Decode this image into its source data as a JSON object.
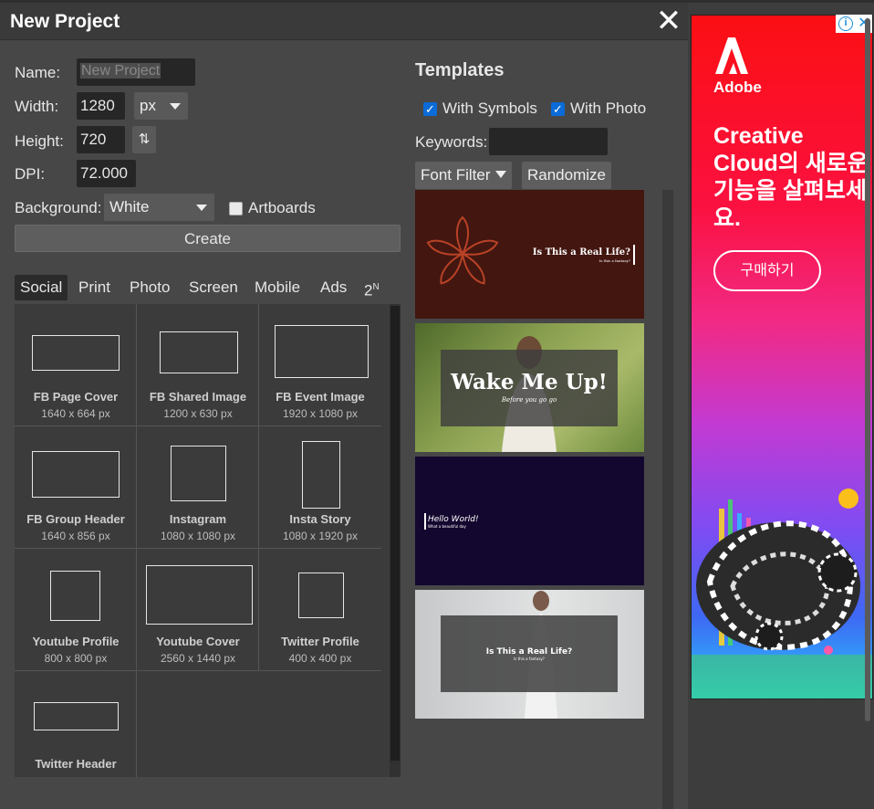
{
  "dialog": {
    "title": "New Project",
    "close_glyph": "✕",
    "form": {
      "name_label": "Name:",
      "name_value": "New Project",
      "width_label": "Width:",
      "width_value": "1280",
      "unit_value": "px",
      "height_label": "Height:",
      "height_value": "720",
      "swap_glyph": "⇅",
      "dpi_label": "DPI:",
      "dpi_value": "72.000",
      "background_label": "Background:",
      "background_value": "White",
      "artboards_label": "Artboards",
      "artboards_checked": false,
      "create_label": "Create"
    },
    "tabs": [
      {
        "label": "Social",
        "active": true
      },
      {
        "label": "Print"
      },
      {
        "label": "Photo"
      },
      {
        "label": "Screen"
      },
      {
        "label": "Mobile"
      },
      {
        "label": "Ads"
      },
      {
        "label": "2",
        "sup": "N"
      }
    ],
    "presets": [
      {
        "name": "FB Page Cover",
        "dims": "1640 x 664 px"
      },
      {
        "name": "FB Shared Image",
        "dims": "1200 x 630 px"
      },
      {
        "name": "FB Event Image",
        "dims": "1920 x 1080 px"
      },
      {
        "name": "FB Group Header",
        "dims": "1640 x 856 px"
      },
      {
        "name": "Instagram",
        "dims": "1080 x 1080 px"
      },
      {
        "name": "Insta Story",
        "dims": "1080 x 1920 px"
      },
      {
        "name": "Youtube Profile",
        "dims": "800 x 800 px"
      },
      {
        "name": "Youtube Cover",
        "dims": "2560 x 1440 px"
      },
      {
        "name": "Twitter Profile",
        "dims": "400 x 400 px"
      },
      {
        "name": "Twitter Header",
        "dims": ""
      }
    ],
    "templates": {
      "heading": "Templates",
      "with_symbols_label": "With Symbols",
      "with_symbols_checked": true,
      "with_photo_label": "With Photo",
      "with_photo_checked": true,
      "keywords_label": "Keywords:",
      "keywords_value": "",
      "font_filter_label": "Font Filter",
      "randomize_label": "Randomize",
      "items": [
        {
          "title": "Is This a Real Life?",
          "subtitle": "Is this a fantasy?",
          "bg": "#431610"
        },
        {
          "title": "Wake Me Up!",
          "subtitle": "Before you go go",
          "bg": "#6a7d3a"
        },
        {
          "title": "Hello World!",
          "subtitle": "What a beautiful day",
          "bg": "#14072f"
        },
        {
          "title": "Is This a Real Life?",
          "subtitle": "Is this a fantasy?",
          "bg": "#d8dadb"
        }
      ]
    }
  },
  "ad": {
    "brand": "Adobe",
    "headline": "Creative Cloud의 새로운 기능을 살펴보세요.",
    "cta": "구매하기",
    "info_glyph": "i",
    "close_glyph": "✕"
  },
  "colors": {
    "accent_checkbox": "#0b6bd8",
    "dialog_bg": "#474747",
    "field_bg": "#262626"
  }
}
